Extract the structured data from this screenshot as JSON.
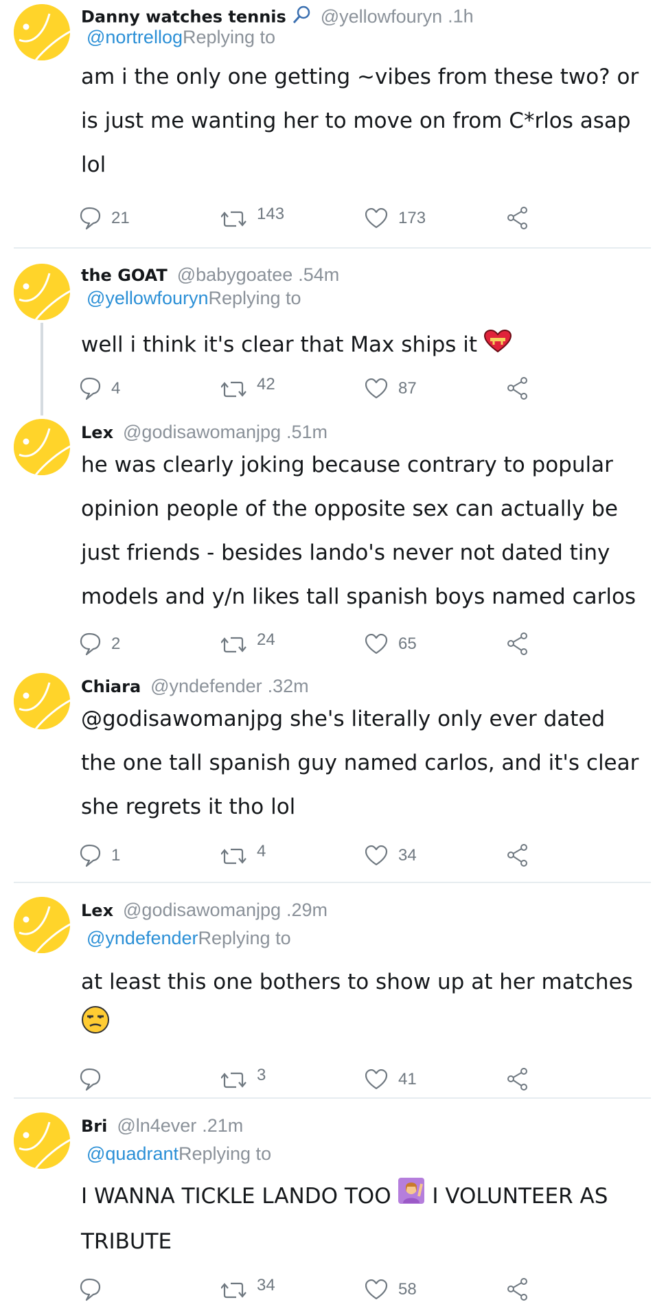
{
  "labels": {
    "replying_to": "Replying to"
  },
  "tweets": [
    {
      "name": "Danny watches tennis",
      "handle": "@yellowfouryn",
      "time": ".1h",
      "reply_handle": "@nortrellog",
      "lines": [
        "am i the only one getting ~vibes from these two? or",
        "is just me wanting her to move on from C*rlos asap",
        "lol"
      ],
      "replies": "21",
      "retweets": "143",
      "likes": "173"
    },
    {
      "name": "the GOAT",
      "handle": "@babygoatee",
      "time": ".54m",
      "reply_handle": "@yellowfouryn",
      "lines": [
        "well i think it's clear that Max ships it"
      ],
      "replies": "4",
      "retweets": "42",
      "likes": "87"
    },
    {
      "name": "Lex",
      "handle": "@godisawomanjpg",
      "time": ".51m",
      "lines": [
        "he was clearly joking because contrary to popular",
        "opinion people of the opposite sex can actually be",
        "just friends - besides lando's never not dated tiny",
        "models and y/n likes tall spanish boys named carlos"
      ],
      "replies": "2",
      "retweets": "24",
      "likes": "65"
    },
    {
      "name": "Chiara",
      "handle": "@yndefender",
      "time": ".32m",
      "lines": [
        "@godisawomanjpg she's literally only ever dated",
        "the one tall spanish guy named carlos, and it's clear",
        "she regrets it tho lol"
      ],
      "replies": "1",
      "retweets": "4",
      "likes": "34"
    },
    {
      "name": "Lex",
      "handle": "@godisawomanjpg",
      "time": ".29m",
      "reply_handle": "@yndefender",
      "lines": [
        "at least this one bothers to show up at her matches"
      ],
      "replies": "",
      "retweets": "3",
      "likes": "41"
    },
    {
      "name": "Bri",
      "handle": "@ln4ever",
      "time": ".21m",
      "reply_handle": "@quadrant",
      "lines": [
        "I WANNA TICKLE LANDO TOO",
        "I VOLUNTEER AS",
        "TRIBUTE"
      ],
      "replies": "",
      "retweets": "34",
      "likes": "58"
    }
  ],
  "colors": {
    "avatar": "#ffd42a",
    "link": "#2a8fd6",
    "muted": "#8a9199",
    "divider": "#e6ecf0"
  },
  "icons": [
    "tennis-racket-icon",
    "reply-icon",
    "retweet-icon",
    "like-icon",
    "share-icon",
    "heart-emoji-icon",
    "unamused-face-icon",
    "person-raising-hand-icon"
  ]
}
